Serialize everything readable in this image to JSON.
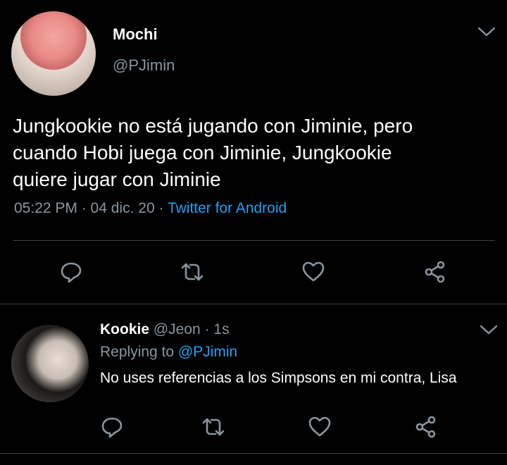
{
  "colors": {
    "background": "#000000",
    "text": "#ffffff",
    "secondary": "#8a959e",
    "accent": "#1da1f2",
    "divider": "#38444d"
  },
  "main_tweet": {
    "name": "Mochi",
    "handle": "@PJimin",
    "text_lines": [
      "Jungkookie no está jugando con Jiminie, pero",
      "cuando Hobi juega con Jiminie, Jungkookie",
      "quiere jugar con Jiminie"
    ],
    "time": "05:22 PM",
    "date": "· 04 dic. 20",
    "source_separator": "·",
    "source": "Twitter for Android",
    "actions": [
      "reply-icon",
      "retweet-icon",
      "like-icon",
      "share-icon"
    ]
  },
  "reply_tweet": {
    "name": "Kookie",
    "handle": "@Jeon",
    "time_ago": "· 1s",
    "replying_label": "Replying to",
    "replying_to": "@PJimin",
    "text": "No uses referencias a los Simpsons en mi contra, Lisa",
    "actions": [
      "reply-icon",
      "retweet-icon",
      "like-icon",
      "share-icon"
    ]
  }
}
